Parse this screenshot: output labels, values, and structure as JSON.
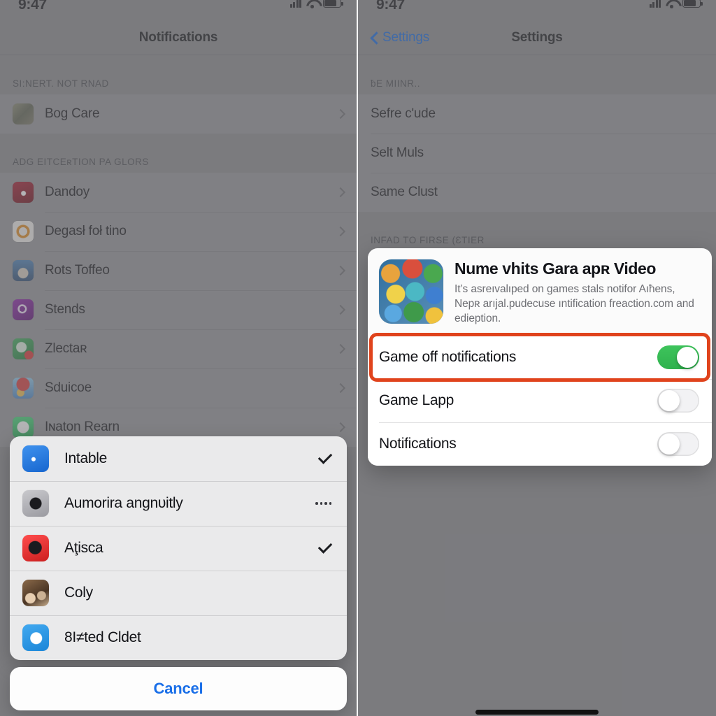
{
  "status_bar": {
    "time": "9:47",
    "cellular_icon": "cellular-bars-icon",
    "wifi_icon": "wifi-icon",
    "battery_icon": "battery-icon"
  },
  "left_screen": {
    "nav": {
      "title": "Notifications"
    },
    "sections": [
      {
        "header": "SI:NERT. NOT RNAD",
        "rows": [
          {
            "label": "Bog Care",
            "icon_color": "#6f6f63"
          }
        ]
      },
      {
        "header": "ADG EITCEʀTION PA GLORS",
        "rows": [
          {
            "label": "Dandoy",
            "icon_color": "#8f1320"
          },
          {
            "label": "Degasł foł tino",
            "icon_color": "#e08a1e"
          },
          {
            "label": "Rots Toffeo",
            "icon_color": "#3f6fa8"
          },
          {
            "label": "Stends",
            "icon_color": "#7b1fa2"
          },
          {
            "label": "Zlectaʀ",
            "icon_color": "#2e9e4f"
          },
          {
            "label": "Sduicoe",
            "icon_color": "#d5473d"
          },
          {
            "label": "Iɴaton Rearn",
            "icon_color": "#25d366"
          }
        ]
      }
    ],
    "action_sheet": {
      "items": [
        {
          "label": "Intable",
          "icon_color": "#2a7de1",
          "trailing": "check"
        },
        {
          "label": "Aumorira angnᴜitly",
          "icon_color": "#8e8e93",
          "trailing": "dots"
        },
        {
          "label": "Aţisca",
          "icon_color": "#f03b3b",
          "trailing": "check"
        },
        {
          "label": "Coly",
          "icon_color": "#6b5138",
          "trailing": "none"
        },
        {
          "label": "8I≠ted Cldet",
          "icon_color": "#2f9fe8",
          "trailing": "none"
        }
      ],
      "cancel_label": "Cancel"
    }
  },
  "right_screen": {
    "nav": {
      "back_label": "Settings",
      "title": "Settings"
    },
    "sections": [
      {
        "header": "ƀE MIINR..",
        "rows": [
          {
            "label": "Sefre ᴄʹude"
          },
          {
            "label": "Selt Muls"
          },
          {
            "label": "Same Clust"
          }
        ]
      },
      {
        "header": "INFAD TO FIRSE (ƐTIER",
        "rows": []
      }
    ],
    "card": {
      "app_title": "Nume vhits Gara apʀ Video",
      "app_description": "It’s asreıvalıped on games stals notifor Aıħens, Nepʀ arıjal.pudecuse ıntification freaction.com and edieption.",
      "toggles": [
        {
          "label": "Game off notifications",
          "on": true,
          "highlighted": true
        },
        {
          "label": "Game Lapp",
          "on": false,
          "highlighted": false
        },
        {
          "label": "Notifications",
          "on": false,
          "highlighted": false
        }
      ]
    }
  },
  "colors": {
    "accent_blue": "#1469e0",
    "toggle_on_green": "#34c759",
    "highlight_orange": "#e0431c",
    "screen_background": "#8a8a8d"
  }
}
